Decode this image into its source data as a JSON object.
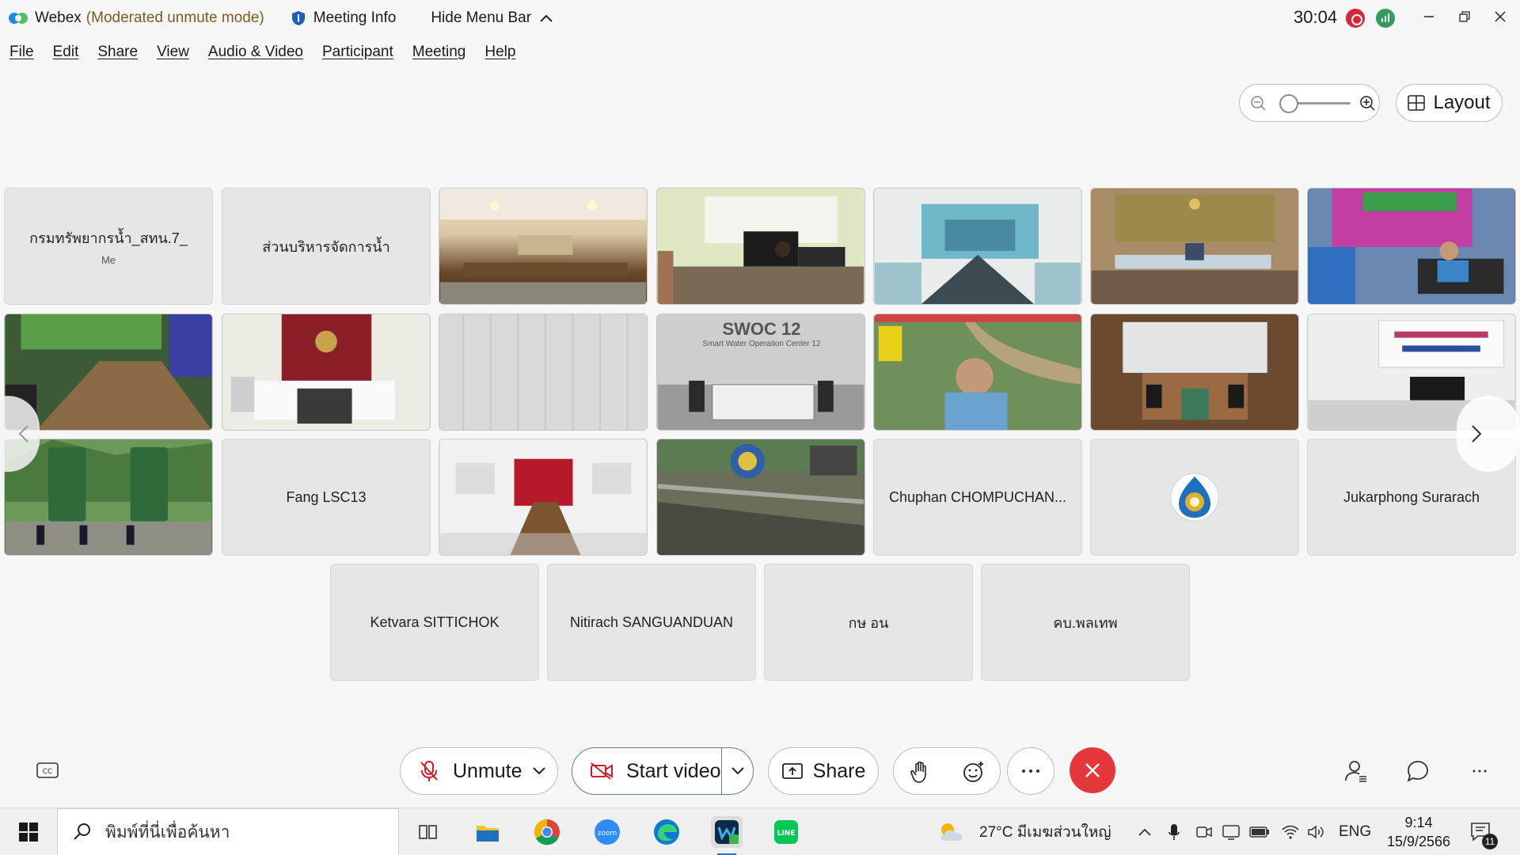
{
  "titlebar": {
    "app_name": "Webex",
    "mode": "(Moderated unmute mode)",
    "meeting_info": "Meeting Info",
    "hide_menu": "Hide Menu Bar",
    "timer": "30:04"
  },
  "menu": [
    "File",
    "Edit",
    "Share",
    "View",
    "Audio & Video",
    "Participant",
    "Meeting",
    "Help"
  ],
  "layout_label": "Layout",
  "tiles": [
    {
      "name": "กรมทรัพยากรน้ำ_สทน.7_",
      "sub": "Me"
    },
    {
      "name": "ส่วนบริหารจัดการน้ำ"
    },
    {
      "name": "Fang LSC13"
    },
    {
      "name": "Chuphan CHOMPUCHAN..."
    },
    {
      "name": "Jukarphong Surarach"
    },
    {
      "name": "Ketvara SITTICHOK"
    },
    {
      "name": "Nitirach SANGUANDUAN"
    },
    {
      "name": "กษ อน"
    },
    {
      "name": "คบ.พลเทพ"
    }
  ],
  "video_tiles": {
    "swoc_sign": "SWOC 12",
    "swoc_sub": "Smart Water Operation Center 12"
  },
  "controls": {
    "unmute": "Unmute",
    "start_video": "Start video",
    "share": "Share"
  },
  "taskbar": {
    "search_placeholder": "พิมพ์ที่นี่เพื่อค้นหา",
    "weather": "27°C  มีเมฆส่วนใหญ่",
    "lang": "ENG",
    "time": "9:14",
    "date": "15/9/2566",
    "notif_count": "11"
  },
  "colors": {
    "accent": "#0a66c2",
    "mode_text": "#7a5b1c",
    "end_call": "#e5383b",
    "record": "#d7263d"
  }
}
